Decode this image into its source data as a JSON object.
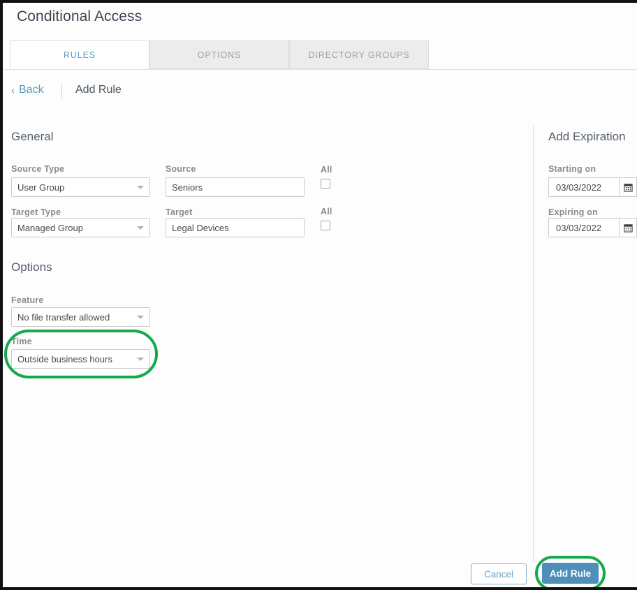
{
  "window": {
    "title": "Conditional Access"
  },
  "tabs": [
    {
      "id": "rules",
      "label": "RULES",
      "active": true
    },
    {
      "id": "options",
      "label": "OPTIONS",
      "active": false
    },
    {
      "id": "dirgroups",
      "label": "DIRECTORY GROUPS",
      "active": false
    }
  ],
  "breadcrumb": {
    "back_label": "Back",
    "back_chevron": "‹",
    "current": "Add Rule"
  },
  "sections": {
    "general": {
      "heading": "General",
      "source_type": {
        "label": "Source Type",
        "value": "User Group"
      },
      "source": {
        "label": "Source",
        "value": "Seniors",
        "all_label": "All",
        "all_checked": false
      },
      "target_type": {
        "label": "Target Type",
        "value": "Managed Group"
      },
      "target": {
        "label": "Target",
        "value": "Legal Devices",
        "all_label": "All",
        "all_checked": false
      }
    },
    "options": {
      "heading": "Options",
      "feature": {
        "label": "Feature",
        "value": "No file transfer allowed"
      },
      "time": {
        "label": "Time",
        "value": "Outside business hours",
        "highlighted": true
      }
    },
    "expiration": {
      "heading": "Add Expiration",
      "starting_on": {
        "label": "Starting on",
        "value": "03/03/2022",
        "calendar_icon": "calendar-icon"
      },
      "expiring_on": {
        "label": "Expiring on",
        "value": "03/03/2022",
        "calendar_icon": "calendar-icon"
      }
    }
  },
  "footer": {
    "cancel_label": "Cancel",
    "add_rule_label": "Add Rule"
  },
  "colors": {
    "accent_blue": "#5b9bc4",
    "primary_button": "#4d8fb8",
    "highlight_green": "#16a84c",
    "label_gray": "#8b8b8b",
    "heading_gray": "#56606c"
  }
}
